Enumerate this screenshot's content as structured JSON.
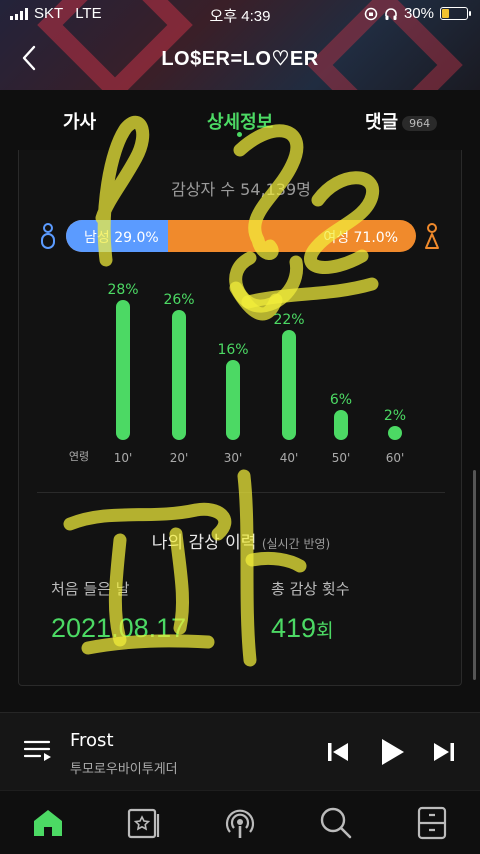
{
  "status": {
    "carrier": "SKT",
    "network": "LTE",
    "time": "오후 4:39",
    "battery": "30%",
    "battery_level": 0.3
  },
  "header": {
    "title": "LO$ER=LO♡ER"
  },
  "tabs": [
    {
      "label": "가사"
    },
    {
      "label": "상세정보"
    },
    {
      "label": "댓글",
      "badge": "964"
    }
  ],
  "listeners": {
    "text": "감상자 수 54,139명"
  },
  "gender": {
    "male_label": "남성 29.0%",
    "female_label": "여성 71.0%",
    "male_share": 0.29
  },
  "chart_data": {
    "type": "bar",
    "xlabel": "연령",
    "categories": [
      "10'",
      "20'",
      "30'",
      "40'",
      "50'",
      "60'"
    ],
    "values": [
      28,
      26,
      16,
      22,
      6,
      2
    ],
    "value_labels": [
      "28%",
      "26%",
      "16%",
      "22%",
      "6%",
      "2%"
    ],
    "color": "#4cd964",
    "ylim": [
      0,
      28
    ]
  },
  "history": {
    "title": "나의 감상 이력",
    "subtitle": "(실시간 반영)",
    "first_label": "처음 들은 날",
    "first_value": "2021.08.17",
    "count_label": "총 감상 횟수",
    "count_value": "419",
    "count_unit": "회"
  },
  "player": {
    "title": "Frost",
    "artist": "투모로우바이투게더"
  },
  "nav": {
    "items": [
      "home-icon",
      "library-icon",
      "podcast-icon",
      "search-icon",
      "drawer-icon"
    ]
  },
  "colors": {
    "accent": "#4cd964",
    "male": "#5b9bff",
    "female": "#f08a2c",
    "scribble": "#f2ee3a"
  }
}
